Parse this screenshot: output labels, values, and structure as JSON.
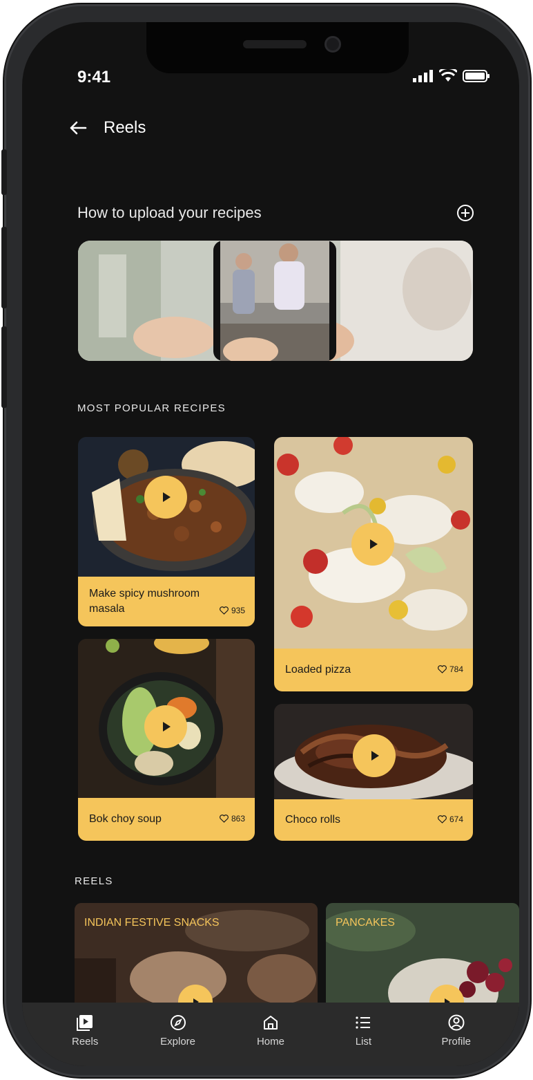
{
  "status_bar": {
    "time": "9:41"
  },
  "header": {
    "title": "Reels",
    "back_icon": "arrow-left-icon"
  },
  "upload": {
    "title": "How to upload your recipes",
    "add_icon": "plus-circle-icon"
  },
  "popular": {
    "section_label": "MOST POPULAR RECIPES",
    "cards": [
      {
        "name": "Make spicy mushroom masala",
        "likes": "935"
      },
      {
        "name": "Loaded pizza",
        "likes": "784"
      },
      {
        "name": "Bok choy soup",
        "likes": "863"
      },
      {
        "name": "Choco rolls",
        "likes": "674"
      }
    ]
  },
  "reels": {
    "section_label": "REELS",
    "items": [
      {
        "label": "INDIAN FESTIVE SNACKS"
      },
      {
        "label": "PANCAKES"
      }
    ]
  },
  "nav": [
    {
      "label": "Reels",
      "icon": "play-square-icon"
    },
    {
      "label": "Explore",
      "icon": "compass-icon"
    },
    {
      "label": "Home",
      "icon": "home-icon"
    },
    {
      "label": "List",
      "icon": "list-icon"
    },
    {
      "label": "Profile",
      "icon": "user-circle-icon"
    }
  ],
  "colors": {
    "accent": "#f5c55b",
    "background": "#121212",
    "nav": "#2b2b2b"
  }
}
